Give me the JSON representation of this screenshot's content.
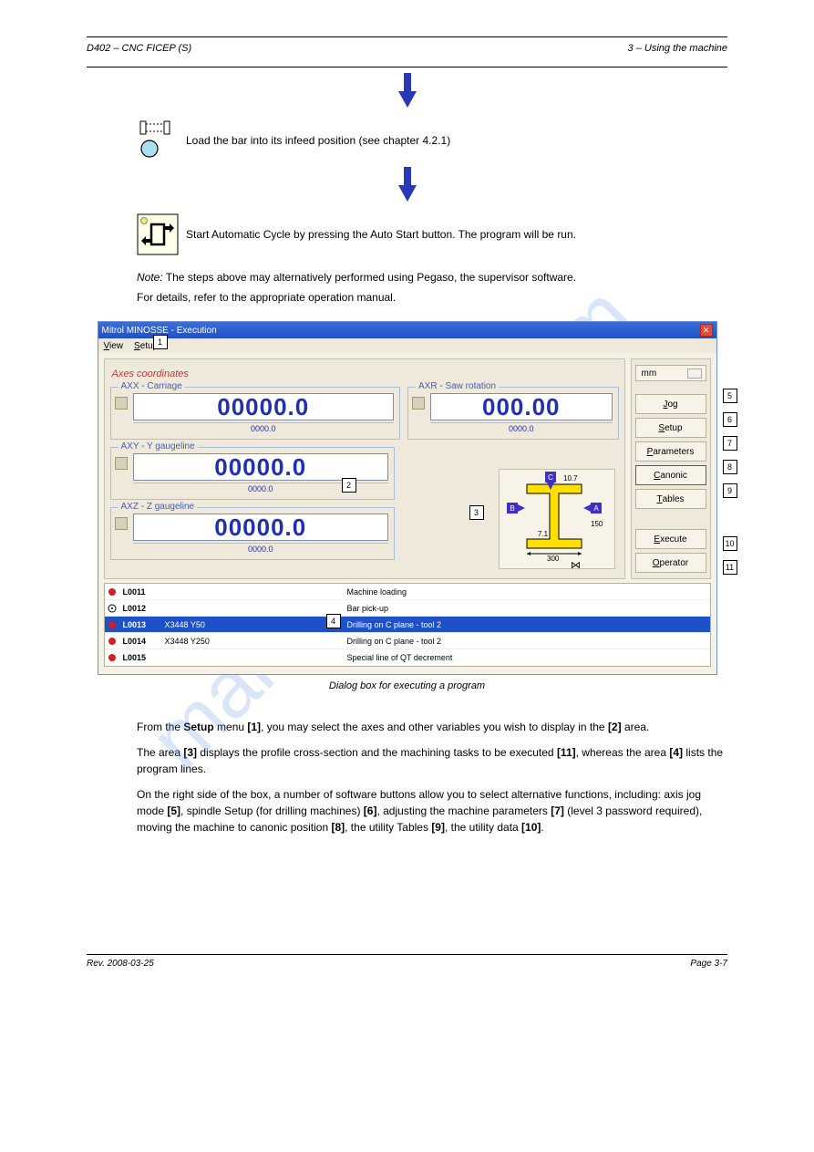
{
  "header": {
    "left": "D402 – CNC FICEP (S)",
    "right": "3 – Using the machine"
  },
  "steps": {
    "load_text": "Load the bar into its infeed position (see chapter 4.2.1)",
    "auto_text": "Start Automatic Cycle by pressing the Auto Start button. The program will be run."
  },
  "note": {
    "line1_em": "Note:",
    "line1_rest": " The steps above may alternatively performed using Pegaso, the supervisor software.",
    "line2": "For details, refer to the appropriate operation manual."
  },
  "caption": "Dialog box for executing a program",
  "screenshot": {
    "title": "Mitrol MINOSSE - Execution",
    "menu": {
      "view": "View",
      "setup": "Setup"
    },
    "section": "Axes coordinates",
    "axes": {
      "axx": {
        "label": "AXX - Carriage",
        "value": "00000.0",
        "sub": "0000.0"
      },
      "axr": {
        "label": "AXR - Saw rotation",
        "value": "000.00",
        "sub": "0000.0"
      },
      "axy": {
        "label": "AXY - Y gaugeline",
        "value": "00000.0",
        "sub": "0000.0"
      },
      "axz": {
        "label": "AXZ - Z gaugeline",
        "value": "00000.0",
        "sub": "0000.0"
      }
    },
    "profile": {
      "w": "300",
      "h": "150",
      "t1": "10.7",
      "t2": "7.1"
    },
    "side": {
      "mm": "mm",
      "jog": "Jog",
      "setup": "Setup",
      "params": "Parameters",
      "canonic": "Canonic",
      "tables": "Tables",
      "execute": "Execute",
      "operator": "Operator"
    },
    "rows": [
      {
        "code": "L0011",
        "coords": "",
        "desc": "Machine loading",
        "ico": "red"
      },
      {
        "code": "L0012",
        "coords": "",
        "desc": "Bar pick-up",
        "ico": "wait"
      },
      {
        "code": "L0013",
        "coords": "X3448 Y50",
        "desc": "Drilling on C plane - tool 2",
        "ico": "red",
        "sel": true
      },
      {
        "code": "L0014",
        "coords": "X3448 Y250",
        "desc": "Drilling on C plane - tool 2",
        "ico": "red"
      },
      {
        "code": "L0015",
        "coords": "",
        "desc": "Special line of QT decrement",
        "ico": "red"
      }
    ]
  },
  "desc": {
    "p1a": "From the ",
    "p1b": "Setup",
    "p1c": " menu ",
    "p1d": "[1]",
    "p1e": ", you may select the axes and other variables you wish to display in the ",
    "p1f": "[2] ",
    "p1g": "area.",
    "p2a": "The area ",
    "p2b": "[3]",
    "p2c": " displays the profile cross-section and the machining tasks to be executed ",
    "p2d": "[11]",
    "p2e": ", whereas the area ",
    "p2f": "[4]",
    "p2g": " lists the program lines.",
    "p3a": "On the right side of the box, a number of software buttons allow you to select alternative functions, including: axis jog mode ",
    "p3b": "[5]",
    "p3c": ", spindle Setup (for drilling machines) ",
    "p3d": "[6]",
    "p3e": ", adjusting the machine parameters ",
    "p3f": "[7]",
    "p3g": " (level 3 password required), moving the machine to canonic position ",
    "p3h": "[8]",
    "p3i": ", the utility Tables ",
    "p3j": "[9]",
    "p3k": ", the utility data ",
    "p3l": "[10]",
    "p3m": "."
  },
  "footer": {
    "left": "Rev. 2008-03-25",
    "right": "Page 3-7"
  }
}
